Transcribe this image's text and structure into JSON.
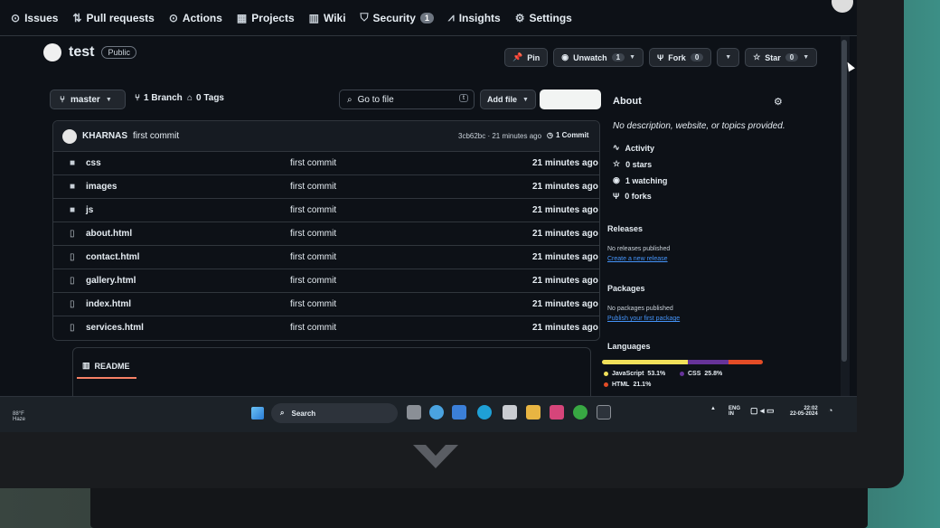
{
  "nav": {
    "items": [
      {
        "label": "Issues",
        "icon": "issue-circle-icon"
      },
      {
        "label": "Pull requests",
        "icon": "pull-request-icon"
      },
      {
        "label": "Actions",
        "icon": "play-icon"
      },
      {
        "label": "Projects",
        "icon": "table-icon"
      },
      {
        "label": "Wiki",
        "icon": "book-icon"
      },
      {
        "label": "Security",
        "icon": "shield-icon",
        "count": "1"
      },
      {
        "label": "Insights",
        "icon": "graph-icon"
      },
      {
        "label": "Settings",
        "icon": "gear-icon"
      }
    ]
  },
  "repo": {
    "name": "test",
    "visibility": "Public",
    "actions": {
      "pin": "Pin",
      "unwatch": "Unwatch",
      "watch_count": "1",
      "fork": "Fork",
      "fork_count": "0",
      "star": "Star",
      "star_count": "0"
    }
  },
  "toolbar": {
    "branch": "master",
    "branches": "1 Branch",
    "tags": "0 Tags",
    "search_placeholder": "Go to file",
    "search_shortcut": "t",
    "add_file": "Add file"
  },
  "latest_commit": {
    "author": "KHARNAS",
    "message": "first commit",
    "meta": "3cb62bc · 21 minutes ago",
    "count": "1 Commit"
  },
  "files": [
    {
      "name": "css",
      "type": "folder",
      "message": "first commit",
      "age": "21 minutes ago"
    },
    {
      "name": "images",
      "type": "folder",
      "message": "first commit",
      "age": "21 minutes ago"
    },
    {
      "name": "js",
      "type": "folder",
      "message": "first commit",
      "age": "21 minutes ago"
    },
    {
      "name": "about.html",
      "type": "file",
      "message": "first commit",
      "age": "21 minutes ago"
    },
    {
      "name": "contact.html",
      "type": "file",
      "message": "first commit",
      "age": "21 minutes ago"
    },
    {
      "name": "gallery.html",
      "type": "file",
      "message": "first commit",
      "age": "21 minutes ago"
    },
    {
      "name": "index.html",
      "type": "file",
      "message": "first commit",
      "age": "21 minutes ago"
    },
    {
      "name": "services.html",
      "type": "file",
      "message": "first commit",
      "age": "21 minutes ago"
    }
  ],
  "readme": {
    "label": "README"
  },
  "about": {
    "title": "About",
    "description": "No description, website, or topics provided.",
    "activity": "Activity",
    "stars": "0 stars",
    "watching": "1 watching",
    "forks": "0 forks"
  },
  "releases": {
    "title": "Releases",
    "empty": "No releases published",
    "link": "Create a new release"
  },
  "packages": {
    "title": "Packages",
    "empty": "No packages published",
    "link": "Publish your first package"
  },
  "languages": {
    "title": "Languages",
    "items": [
      {
        "name": "JavaScript",
        "percent": "53.1%",
        "value": 53.1,
        "color": "#f1e05a"
      },
      {
        "name": "CSS",
        "percent": "25.8%",
        "value": 25.8,
        "color": "#663399"
      },
      {
        "name": "HTML",
        "percent": "21.1%",
        "value": 21.1,
        "color": "#e34c26"
      }
    ]
  },
  "taskbar": {
    "weather_temp": "88°F",
    "weather_desc": "Haze",
    "search": "Search",
    "lang_top": "ENG",
    "lang_bottom": "IN",
    "time": "22:02",
    "date": "22-05-2024"
  },
  "colors": {
    "accent": "#f78166",
    "link": "#4493f8",
    "background": "#0d1117"
  }
}
